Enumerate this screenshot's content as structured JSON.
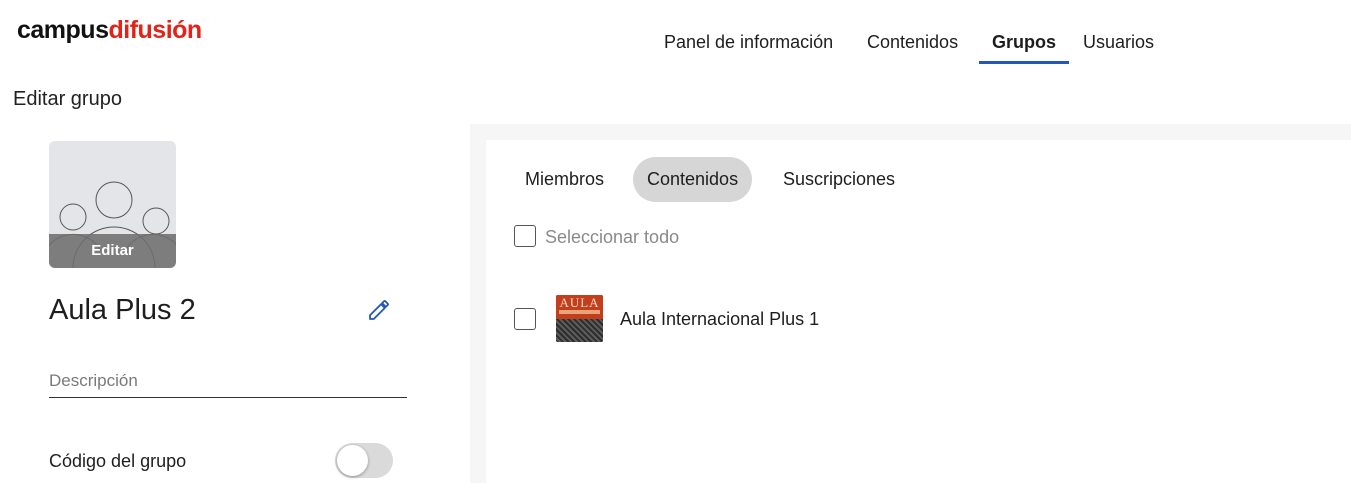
{
  "logo": {
    "part1": "campus",
    "part2": "difusión"
  },
  "nav": {
    "items": [
      {
        "label": "Panel de información",
        "active": false
      },
      {
        "label": "Contenidos",
        "active": false
      },
      {
        "label": "Grupos",
        "active": true
      },
      {
        "label": "Usuarios",
        "active": false
      }
    ]
  },
  "page": {
    "title": "Editar grupo"
  },
  "group": {
    "image_edit_label": "Editar",
    "name": "Aula Plus 2",
    "description_placeholder": "Descripción",
    "description_value": "",
    "code_label": "Código del grupo",
    "code_enabled": false
  },
  "tabs": {
    "members": "Miembros",
    "contents": "Contenidos",
    "subscriptions": "Suscripciones",
    "active": "Contenidos"
  },
  "contents": {
    "select_all_label": "Seleccionar todo",
    "items": [
      {
        "title": "Aula Internacional Plus 1",
        "cover_text": "AULA",
        "checked": false
      }
    ]
  },
  "colors": {
    "accent": "#2458b8",
    "brand_red": "#e2231a",
    "active_tab_bg": "#d6d6d6"
  }
}
